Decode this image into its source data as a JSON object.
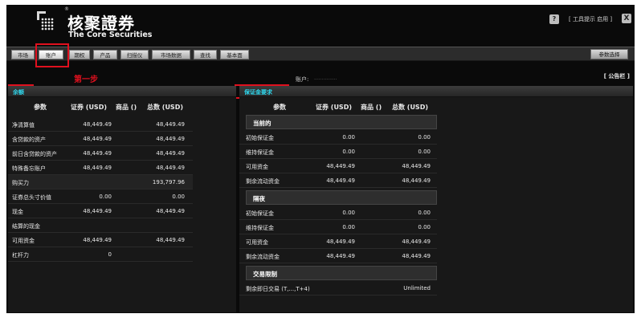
{
  "header": {
    "brand_cn": "核聚證券",
    "brand_en": "The Core Securities",
    "registered": "®",
    "help_icon_glyph": "?",
    "help_label": "[ 工具提示 启用 ]",
    "close_icon_glyph": "X",
    "icons": [
      "logo",
      "help-icon",
      "close-icon"
    ]
  },
  "tabs": [
    {
      "label": "市场",
      "active": false
    },
    {
      "label": "账户",
      "active": true
    },
    {
      "label": "期权",
      "active": false
    },
    {
      "label": "产品",
      "active": false
    },
    {
      "label": "扫描仪",
      "active": false
    },
    {
      "label": "市场数据",
      "active": false
    },
    {
      "label": "查找",
      "active": false
    },
    {
      "label": "基本面",
      "active": false
    }
  ],
  "param_button": "参数选择",
  "annotation": {
    "step": "第一步"
  },
  "account": {
    "label": "账户:",
    "value": "..............."
  },
  "bulletin": "[ 公告栏 ]",
  "balances": {
    "title": "余额",
    "columns": [
      "参数",
      "证券 (USD)",
      "商品 ()",
      "总数 (USD)"
    ],
    "rows": [
      {
        "label": "净清算值",
        "sec": "48,449.49",
        "com": "",
        "total": "48,449.49"
      },
      {
        "label": "含贷款的资产",
        "sec": "48,449.49",
        "com": "",
        "total": "48,449.49"
      },
      {
        "label": "前日含贷款的资产",
        "sec": "48,449.49",
        "com": "",
        "total": "48,449.49"
      },
      {
        "label": "特殊备忘账户",
        "sec": "48,449.49",
        "com": "",
        "total": "48,449.49"
      },
      {
        "label": "购买力",
        "sec": "",
        "com": "",
        "total": "193,797.96"
      },
      {
        "label": "证券总头寸价值",
        "sec": "0.00",
        "com": "",
        "total": "0.00"
      },
      {
        "label": "现金",
        "sec": "48,449.49",
        "com": "",
        "total": "48,449.49"
      },
      {
        "label": "结算的现金",
        "sec": "",
        "com": "",
        "total": ""
      },
      {
        "label": "可用资金",
        "sec": "48,449.49",
        "com": "",
        "total": "48,449.49"
      },
      {
        "label": "杠杆力",
        "sec": "0",
        "com": "",
        "total": ""
      }
    ]
  },
  "margin": {
    "title": "保证金要求",
    "columns": [
      "参数",
      "证券 (USD)",
      "商品 ()",
      "总数 (USD)"
    ],
    "sections": [
      {
        "title": "当前的",
        "rows": [
          {
            "label": "初始保证金",
            "sec": "0.00",
            "total": "0.00"
          },
          {
            "label": "维持保证金",
            "sec": "0.00",
            "total": "0.00"
          },
          {
            "label": "可用资金",
            "sec": "48,449.49",
            "total": "48,449.49"
          },
          {
            "label": "剩余流动资金",
            "sec": "48,449.49",
            "total": "48,449.49"
          }
        ]
      },
      {
        "title": "隔夜",
        "rows": [
          {
            "label": "初始保证金",
            "sec": "0.00",
            "total": "0.00"
          },
          {
            "label": "维持保证金",
            "sec": "0.00",
            "total": "0.00"
          },
          {
            "label": "可用资金",
            "sec": "48,449.49",
            "total": "48,449.49"
          },
          {
            "label": "剩余流动资金",
            "sec": "48,449.49",
            "total": "48,449.49"
          }
        ]
      },
      {
        "title": "交易限制",
        "rows": [
          {
            "label": "剩余即日交易 (T,...,T+4)",
            "sec": "",
            "total": "Unlimited"
          }
        ]
      }
    ]
  },
  "colors": {
    "accent_cyan": "#2fd8ee",
    "highlight_red": "#e0101e",
    "background": "#0a0a0a"
  }
}
